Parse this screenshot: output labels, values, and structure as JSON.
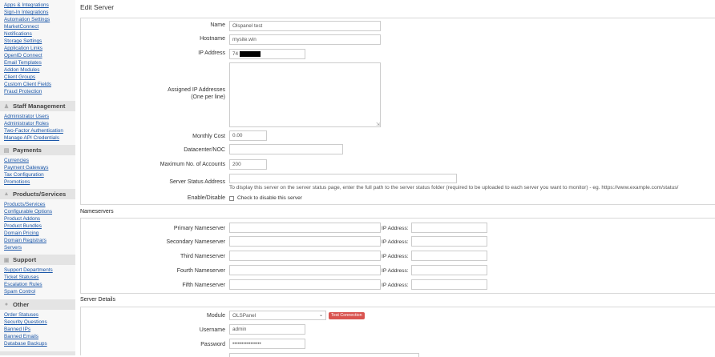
{
  "sidebar": {
    "links_top": [
      "Apps & Integrations",
      "Sign-In Integrations",
      "Automation Settings",
      "MarketConnect",
      "Notifications",
      "Storage Settings",
      "Application Links",
      "OpenID Connect",
      "Email Templates",
      "Addon Modules",
      "Client Groups",
      "Custom Client Fields",
      "Fraud Protection"
    ],
    "staff": {
      "title": "Staff Management",
      "icon": "user-icon",
      "links": [
        "Administrator Users",
        "Administrator Roles",
        "Two-Factor Authentication",
        "Manage API Credentials"
      ]
    },
    "payments": {
      "title": "Payments",
      "icon": "credit-card-icon",
      "links": [
        "Currencies",
        "Payment Gateways",
        "Tax Configuration",
        "Promotions"
      ]
    },
    "products": {
      "title": "Products/Services",
      "icon": "cube-icon",
      "links": [
        "Products/Services",
        "Configurable Options",
        "Product Addons",
        "Product Bundles",
        "Domain Pricing",
        "Domain Registrars",
        "Servers"
      ]
    },
    "support": {
      "title": "Support",
      "icon": "support-icon",
      "links": [
        "Support Departments",
        "Ticket Statuses",
        "Escalation Rules",
        "Spam Control"
      ]
    },
    "other": {
      "title": "Other",
      "icon": "circle-icon",
      "links": [
        "Order Statuses",
        "Security Questions",
        "Banned IPs",
        "Banned Emails",
        "Database Backups"
      ]
    }
  },
  "page": {
    "title": "Edit Server",
    "fields": {
      "name": {
        "label": "Name",
        "value": "Olspanel test"
      },
      "hostname": {
        "label": "Hostname",
        "value": "mysite.win"
      },
      "ip": {
        "label": "IP Address",
        "value": "74"
      },
      "assigned_ips": {
        "label1": "Assigned IP Addresses",
        "label2": "(One per line)",
        "value": ""
      },
      "monthly_cost": {
        "label": "Monthly Cost",
        "value": "0.00"
      },
      "datacenter": {
        "label": "Datacenter/NOC",
        "value": ""
      },
      "max_accounts": {
        "label": "Maximum No. of Accounts",
        "value": "200"
      },
      "status_address": {
        "label": "Server Status Address",
        "value": "",
        "help": "To display this server on the server status page, enter the full path to the server status folder (required to be uploaded to each server you want to monitor) - eg. https://www.example.com/status/"
      },
      "enable": {
        "label": "Enable/Disable",
        "checkbox_label": "Check to disable this server"
      }
    },
    "nameservers": {
      "title": "Nameservers",
      "ip_label": "IP Address:",
      "items": [
        {
          "label": "Primary Nameserver",
          "value": "",
          "ip": ""
        },
        {
          "label": "Secondary Nameserver",
          "value": "",
          "ip": ""
        },
        {
          "label": "Third Nameserver",
          "value": "",
          "ip": ""
        },
        {
          "label": "Fourth Nameserver",
          "value": "",
          "ip": ""
        },
        {
          "label": "Fifth Nameserver",
          "value": "",
          "ip": ""
        }
      ]
    },
    "server_details": {
      "title": "Server Details",
      "module": {
        "label": "Module",
        "value": "OLSPanel"
      },
      "test_button": "Test Connection",
      "username": {
        "label": "Username",
        "value": "admin"
      },
      "password": {
        "label": "Password",
        "value": "••••••••••••••••"
      }
    }
  }
}
